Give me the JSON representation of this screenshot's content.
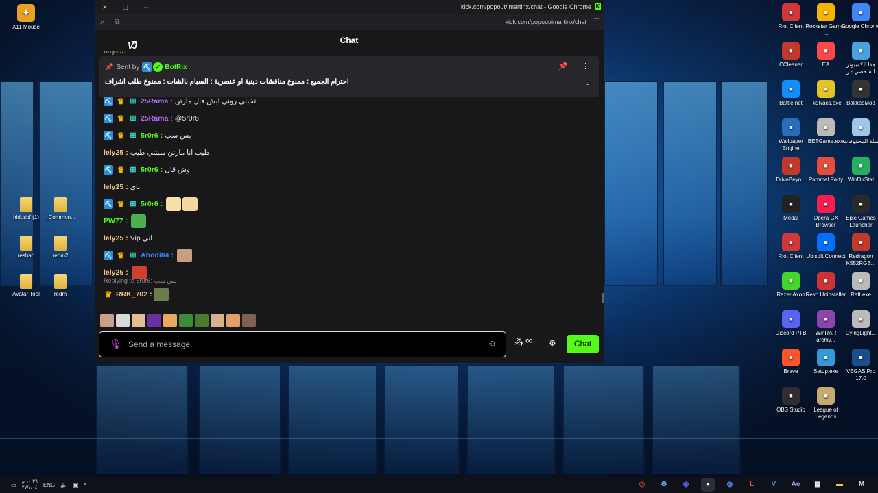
{
  "desktop": {
    "left_icons": [
      {
        "label": "X11 Mouse",
        "icon": "x11-mouse-icon",
        "color": "#e8a020"
      },
      {
        "label": "hidusbf (1)",
        "icon": "folder-icon"
      },
      {
        "label": "_Common...",
        "icon": "folder-icon"
      },
      {
        "label": "reshad",
        "icon": "folder-icon"
      },
      {
        "label": "redm2",
        "icon": "folder-icon"
      },
      {
        "label": "Avatar Tool",
        "icon": "folder-icon"
      },
      {
        "label": "redm",
        "icon": "folder-icon"
      }
    ],
    "right_icons": [
      {
        "label": "Riot Client",
        "icon": "riot-client-icon",
        "color": "#d13639"
      },
      {
        "label": "Rockstar Games ...",
        "icon": "rockstar-icon",
        "color": "#f4b400"
      },
      {
        "label": "Google Chrome",
        "icon": "chrome-icon",
        "color": "#4285f4"
      },
      {
        "label": "CCleaner",
        "icon": "ccleaner-icon",
        "color": "#c0392b"
      },
      {
        "label": "EA",
        "icon": "ea-icon",
        "color": "#ff4747"
      },
      {
        "label": "هذا الكمبيوتر الشخصي - ر",
        "icon": "this-pc-icon",
        "color": "#4aa3df"
      },
      {
        "label": "Battle.net",
        "icon": "battlenet-icon",
        "color": "#148eff"
      },
      {
        "label": "RidNacs.exe",
        "icon": "ridnacs-icon",
        "color": "#e6c229"
      },
      {
        "label": "BakkesMod",
        "icon": "bakkesmod-icon",
        "color": "#333333"
      },
      {
        "label": "Wallpaper Engine",
        "icon": "wallpaper-engine-icon",
        "color": "#2a6ebb"
      },
      {
        "label": "BETGame.exe",
        "icon": "betgame-icon",
        "color": "#bbbbbb"
      },
      {
        "label": "سلة المحذوفات",
        "icon": "recycle-bin-icon",
        "color": "#9fc5e8"
      },
      {
        "label": "DriveBeyo...",
        "icon": "drivebeyond-icon",
        "color": "#c0392b"
      },
      {
        "label": "Pummel Party",
        "icon": "pummel-party-icon",
        "color": "#e74c3c"
      },
      {
        "label": "WinDirStat",
        "icon": "windirstat-icon",
        "color": "#27ae60"
      },
      {
        "label": "Medal",
        "icon": "medal-icon",
        "color": "#222222"
      },
      {
        "label": "Opera GX Browser",
        "icon": "opera-gx-icon",
        "color": "#fa1e4e"
      },
      {
        "label": "Epic Games Launcher",
        "icon": "epic-games-icon",
        "color": "#2a2a2a"
      },
      {
        "label": "Riot Client",
        "icon": "riot-client-icon",
        "color": "#d13639"
      },
      {
        "label": "Ubisoft Connect",
        "icon": "ubisoft-icon",
        "color": "#0070ff"
      },
      {
        "label": "Redragon K552RGB...",
        "icon": "redragon-icon",
        "color": "#c0392b"
      },
      {
        "label": "Razer Axon",
        "icon": "razer-axon-icon",
        "color": "#44d62c"
      },
      {
        "label": "Revo Uninstaller",
        "icon": "revo-icon",
        "color": "#cc3333"
      },
      {
        "label": "Raft.exe",
        "icon": "raft-icon",
        "color": "#bbbbbb"
      },
      {
        "label": "Discord PTB",
        "icon": "discord-icon",
        "color": "#5865f2"
      },
      {
        "label": "WinRAR archiv...",
        "icon": "winrar-icon",
        "color": "#8e44ad"
      },
      {
        "label": "DyingLight...",
        "icon": "dyinglight-icon",
        "color": "#bbbbbb"
      },
      {
        "label": "Brave",
        "icon": "brave-icon",
        "color": "#fb542b"
      },
      {
        "label": "Setup.exe",
        "icon": "setup-icon",
        "color": "#3498db"
      },
      {
        "label": "VEGAS Pro 17.0",
        "icon": "vegas-icon",
        "color": "#1a4f8b"
      },
      {
        "label": "OBS Studio",
        "icon": "obs-icon",
        "color": "#302e31"
      },
      {
        "label": "League of Legends",
        "icon": "lol-icon",
        "color": "#c8aa6e"
      }
    ]
  },
  "browser": {
    "window_title": "kick.com/popout/imartinx/chat - Google Chrome",
    "url": "kick.com/popout/imartinx/chat",
    "close_icon": "×",
    "maximize_icon": "□",
    "minimize_icon": "–"
  },
  "chat": {
    "header_title": "Chat",
    "logo_text": "V͞J",
    "pinned": {
      "sent_by_label": "Sent by",
      "bot_name": "BotRix",
      "text": "احترام الجميع : ممنوع مناقشات دينية او عنصرية : السبام بالشات : ممنوع طلب اشراف"
    },
    "messages": [
      {
        "user": "25Rama",
        "color": "#b56cf5",
        "badges": true,
        "text": "تخبلي روني ابش قال مارتن",
        "emotes": []
      },
      {
        "user": "25Rama",
        "color": "#b56cf5",
        "badges": true,
        "text": "@5r0r6",
        "emotes": []
      },
      {
        "user": "5r0r6",
        "color": "#53fc18",
        "badges": true,
        "text": "بس سب",
        "emotes": []
      },
      {
        "user": "lely25",
        "color": "#f5c58a",
        "badges": false,
        "text": "طيب انا مارتن سبتني طيب",
        "emotes": []
      },
      {
        "user": "5r0r6",
        "color": "#53fc18",
        "badges": true,
        "text": "وش قال",
        "emotes": []
      },
      {
        "user": "lely25",
        "color": "#f5c58a",
        "badges": false,
        "text": "باي",
        "emotes": []
      },
      {
        "user": "5r0r6",
        "color": "#53fc18",
        "badges": true,
        "text": "",
        "emotes": [
          "#f6e0a8",
          "#f3d9a0"
        ]
      },
      {
        "user": "PW77",
        "color": "#53fc18",
        "badges": false,
        "text": "",
        "emotes": [
          "#4caf50"
        ]
      },
      {
        "user": "lely25",
        "color": "#f5c58a",
        "badges": false,
        "text": "Vip اني",
        "emotes": []
      },
      {
        "user": "Abodi84",
        "color": "#3b82f6",
        "badges": true,
        "text": "",
        "emotes": [
          "#c8a080"
        ]
      },
      {
        "user": "lely25",
        "color": "#f5c58a",
        "badges": false,
        "text": "",
        "emotes": [
          "#d04030"
        ]
      }
    ],
    "reply": {
      "text": "Replying to 5r0r6: بس سب"
    },
    "reply_msg": {
      "user": "RRK_702",
      "color": "#f5c58a",
      "emote": "#6b7d4a"
    },
    "emote_bar": [
      "#c9a08a",
      "#d9d9d9",
      "#e0c090",
      "#6a2fa0",
      "#e8a860",
      "#3d8a3a",
      "#4a7a30",
      "#d8b090",
      "#e0a070",
      "#806050"
    ],
    "input_placeholder": "Send a message",
    "send_button": "Chat"
  },
  "taskbar": {
    "time": "١٠:٣٦ م",
    "date": "٢٧/١/٠٤",
    "language": "ENG",
    "apps": [
      {
        "icon": "riot-taskbar-icon",
        "glyph": "◎",
        "color": "#d13639"
      },
      {
        "icon": "steam-icon",
        "glyph": "⚙",
        "color": "#66c0f4"
      },
      {
        "icon": "discord-taskbar-icon",
        "glyph": "◉",
        "color": "#5865f2"
      },
      {
        "icon": "obs-taskbar-icon",
        "glyph": "●",
        "color": "#ffffff"
      },
      {
        "icon": "chrome-taskbar-icon",
        "glyph": "◍",
        "color": "#4285f4"
      },
      {
        "icon": "app-l-icon",
        "glyph": "L",
        "color": "#e74c3c"
      },
      {
        "icon": "vegas-taskbar-icon",
        "glyph": "V",
        "color": "#3a8fd6"
      },
      {
        "icon": "after-effects-icon",
        "glyph": "Ae",
        "color": "#9999ff"
      },
      {
        "icon": "store-icon",
        "glyph": "▦",
        "color": "#f0f0f0"
      },
      {
        "icon": "file-explorer-icon",
        "glyph": "▬",
        "color": "#f4c430"
      },
      {
        "icon": "medal-taskbar-icon",
        "glyph": "M",
        "color": "#dddddd"
      }
    ]
  }
}
